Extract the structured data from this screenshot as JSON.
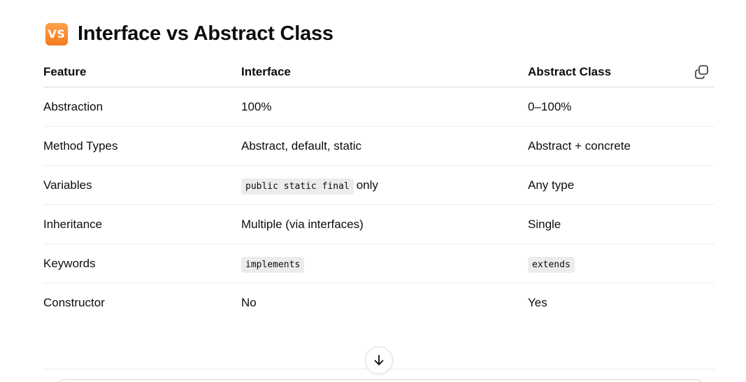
{
  "heading": {
    "badge": "VS",
    "title": "Interface vs Abstract Class"
  },
  "table": {
    "headers": [
      "Feature",
      "Interface",
      "Abstract Class"
    ],
    "rows": [
      {
        "feature": "Abstraction",
        "interface": "100%",
        "abstract": "0–100%"
      },
      {
        "feature": "Method Types",
        "interface": "Abstract, default, static",
        "abstract": "Abstract + concrete"
      },
      {
        "feature": "Variables",
        "interface_code": "public static final",
        "interface_suffix": "only",
        "abstract": "Any type"
      },
      {
        "feature": "Inheritance",
        "interface": "Multiple (via interfaces)",
        "abstract": "Single"
      },
      {
        "feature": "Keywords",
        "interface_code": "implements",
        "abstract_code": "extends"
      },
      {
        "feature": "Constructor",
        "interface": "No",
        "abstract": "Yes"
      }
    ]
  },
  "icons": {
    "copy": "copy-icon",
    "scroll_down": "arrow-down-icon"
  },
  "colors": {
    "badge_orange": "#f47a1e",
    "code_bg": "#ececec",
    "text": "#0d0d0d"
  }
}
